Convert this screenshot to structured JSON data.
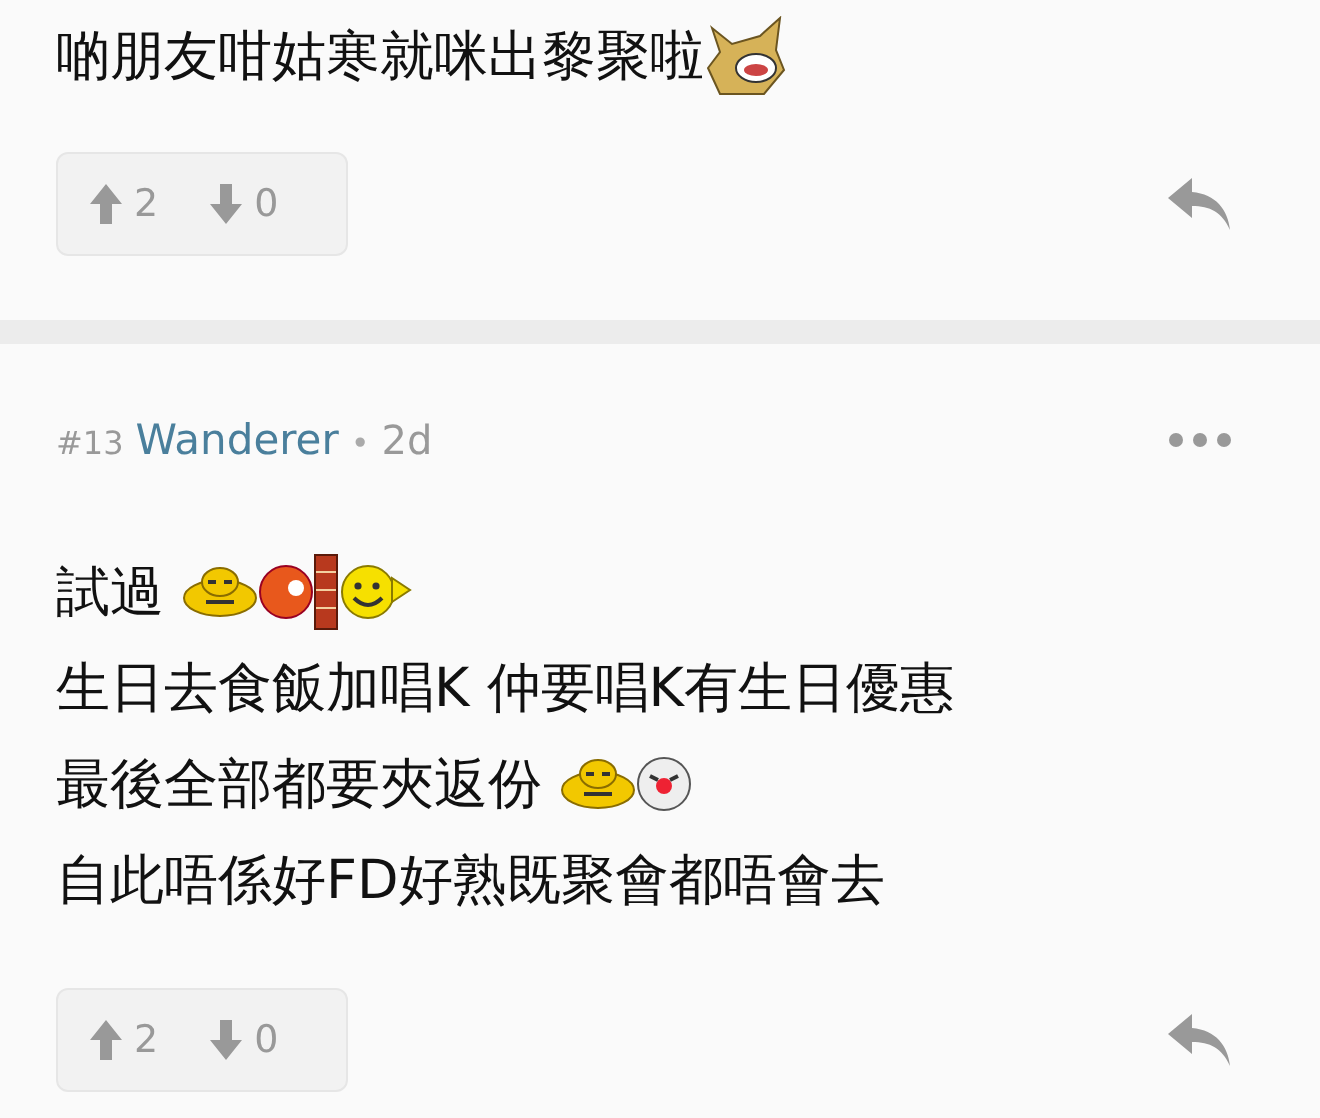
{
  "comments": [
    {
      "lines": [
        [
          {
            "kind": "text",
            "text": "啲朋友咁姑寒就咪出黎聚啦"
          },
          {
            "kind": "dog"
          }
        ]
      ],
      "votes": {
        "up": "2",
        "down": "0"
      }
    },
    {
      "header": {
        "number": "#13",
        "author": "Wanderer",
        "separator": "•",
        "age": "2d"
      },
      "lines": [
        [
          {
            "kind": "text",
            "text": "試過 "
          },
          {
            "kind": "frog"
          },
          {
            "kind": "ball"
          },
          {
            "kind": "bricks"
          },
          {
            "kind": "smiley"
          }
        ],
        [
          {
            "kind": "text",
            "text": "生日去食飯加唱K 仲要唱K有生日優惠"
          }
        ],
        [
          {
            "kind": "text",
            "text": "最後全部都要夾返份 "
          },
          {
            "kind": "frog"
          },
          {
            "kind": "clown"
          }
        ],
        [
          {
            "kind": "text",
            "text": "自此唔係好FD好熟既聚會都唔會去"
          }
        ]
      ],
      "votes": {
        "up": "2",
        "down": "0"
      }
    }
  ]
}
